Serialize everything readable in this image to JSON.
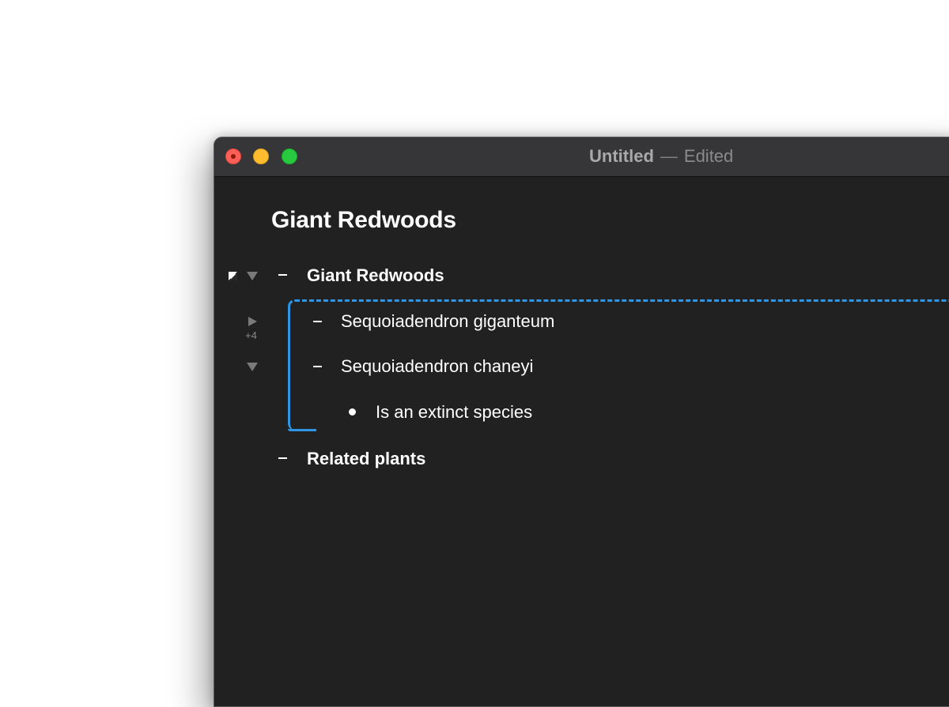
{
  "window": {
    "title": "Untitled",
    "separator": "—",
    "status": "Edited"
  },
  "document": {
    "title": "Giant Redwoods"
  },
  "outline": {
    "root": {
      "label": "Giant Redwoods",
      "marker": "dash"
    },
    "children": [
      {
        "label": "Sequoiadendron giganteum",
        "marker": "dash",
        "collapsed": true,
        "hidden_count": "+4"
      },
      {
        "label": "Sequoiadendron chaneyi",
        "marker": "dash",
        "collapsed": false
      },
      {
        "label": "Is an extinct species",
        "marker": "bullet"
      }
    ],
    "sibling": {
      "label": "Related plants",
      "marker": "dash"
    }
  },
  "icons": {
    "focus": "focus-toggle-icon",
    "expanded": "disclosure-down-icon",
    "collapsed": "disclosure-right-icon"
  },
  "colors": {
    "window_bg": "#212121",
    "titlebar_bg": "#363638",
    "selection": "#2f95e6",
    "close": "#ff5f57",
    "minimize": "#febc2e",
    "zoom": "#28c840"
  }
}
